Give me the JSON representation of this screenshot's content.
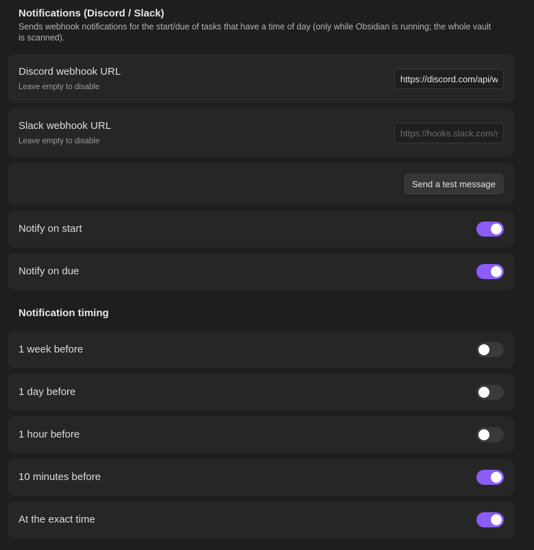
{
  "section": {
    "title": "Notifications (Discord / Slack)",
    "description": "Sends webhook notifications for the start/due of tasks that have a time of day (only while Obsidian is running; the whole vault is scanned)."
  },
  "discord": {
    "label": "Discord webhook URL",
    "hint": "Leave empty to disable",
    "value": "https://discord.com/api/webhooks/",
    "placeholder": ""
  },
  "slack": {
    "label": "Slack webhook URL",
    "hint": "Leave empty to disable",
    "value": "",
    "placeholder": "https://hooks.slack.com/services/"
  },
  "test_button": {
    "label": "Send a test message"
  },
  "notify_start": {
    "label": "Notify on start",
    "enabled": true
  },
  "notify_due": {
    "label": "Notify on due",
    "enabled": true
  },
  "timing": {
    "heading": "Notification timing",
    "items": [
      {
        "label": "1 week before",
        "enabled": false
      },
      {
        "label": "1 day before",
        "enabled": false
      },
      {
        "label": "1 hour before",
        "enabled": false
      },
      {
        "label": "10 minutes before",
        "enabled": true
      },
      {
        "label": "At the exact time",
        "enabled": true
      }
    ]
  },
  "colors": {
    "background": "#1e1e1e",
    "card": "#262626",
    "accent": "#8b5cf6",
    "toggle_off": "#3a3a3a"
  }
}
